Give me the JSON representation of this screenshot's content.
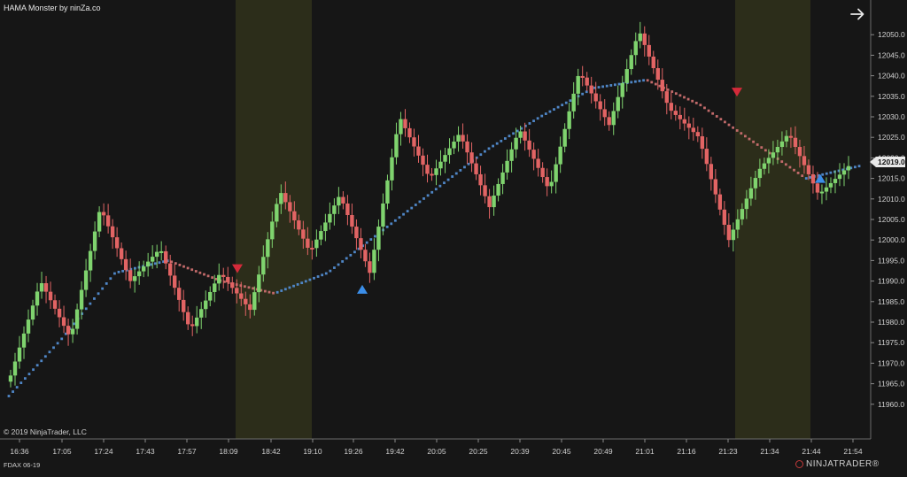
{
  "header": {
    "title": "HAMA Monster by ninZa.co"
  },
  "footer": {
    "copyright": "© 2019 NinjaTrader, LLC",
    "instrument": "FDAX 06-19",
    "brand": "NINJATRADER",
    "brand_suffix": "®"
  },
  "icons": {
    "nav": "arrow-right-icon"
  },
  "colors": {
    "background": "#161616",
    "up_candle": "#7fd36e",
    "down_candle": "#e26464",
    "hama_up": "#4f86c6",
    "hama_down": "#c26a6a",
    "highlight_zone": "#2c2d1a",
    "buy_marker": "#3b8ee8",
    "sell_marker": "#d42a3a"
  },
  "chart_data": {
    "type": "candlestick",
    "price_axis": {
      "min": 11955,
      "max": 12055,
      "ticks": [
        "12050.0",
        "12045.0",
        "12040.0",
        "12035.0",
        "12030.0",
        "12025.0",
        "12020.0",
        "12015.0",
        "12010.0",
        "12005.0",
        "12000.0",
        "11995.0",
        "11990.0",
        "11985.0",
        "11980.0",
        "11975.0",
        "11970.0",
        "11965.0",
        "11960.0"
      ],
      "current_price": "12019.0"
    },
    "time_axis": {
      "ticks": [
        "16:36",
        "17:05",
        "17:24",
        "17:43",
        "17:57",
        "18:09",
        "18:42",
        "19:10",
        "19:26",
        "19:42",
        "20:05",
        "20:25",
        "20:39",
        "20:45",
        "20:49",
        "21:01",
        "21:16",
        "21:23",
        "21:34",
        "21:44",
        "21:54"
      ]
    },
    "price_path": [
      11967,
      11990,
      11976,
      12008,
      11990,
      11998,
      11978,
      11992,
      11983,
      12012,
      11997,
      12011,
      11992,
      12030,
      12015,
      12026,
      12008,
      12027,
      12012,
      12041,
      12028,
      12051,
      12032,
      12025,
      12000,
      12017,
      12026,
      12011,
      12018
    ],
    "hama_path": [
      11962,
      11976,
      11992,
      11995,
      11990,
      11987,
      11992,
      12002,
      12012,
      12022,
      12030,
      12037,
      12039,
      12033,
      12024,
      12015,
      12018
    ],
    "highlight_zones": [
      [
        5,
        7
      ],
      [
        17,
        19
      ]
    ],
    "signals": [
      {
        "type": "sell",
        "tick": 5,
        "price": 11993
      },
      {
        "type": "buy",
        "tick": 8,
        "price": 11988
      },
      {
        "type": "sell",
        "tick": 17,
        "price": 12036
      },
      {
        "type": "buy",
        "tick": 19,
        "price": 12015
      }
    ]
  }
}
